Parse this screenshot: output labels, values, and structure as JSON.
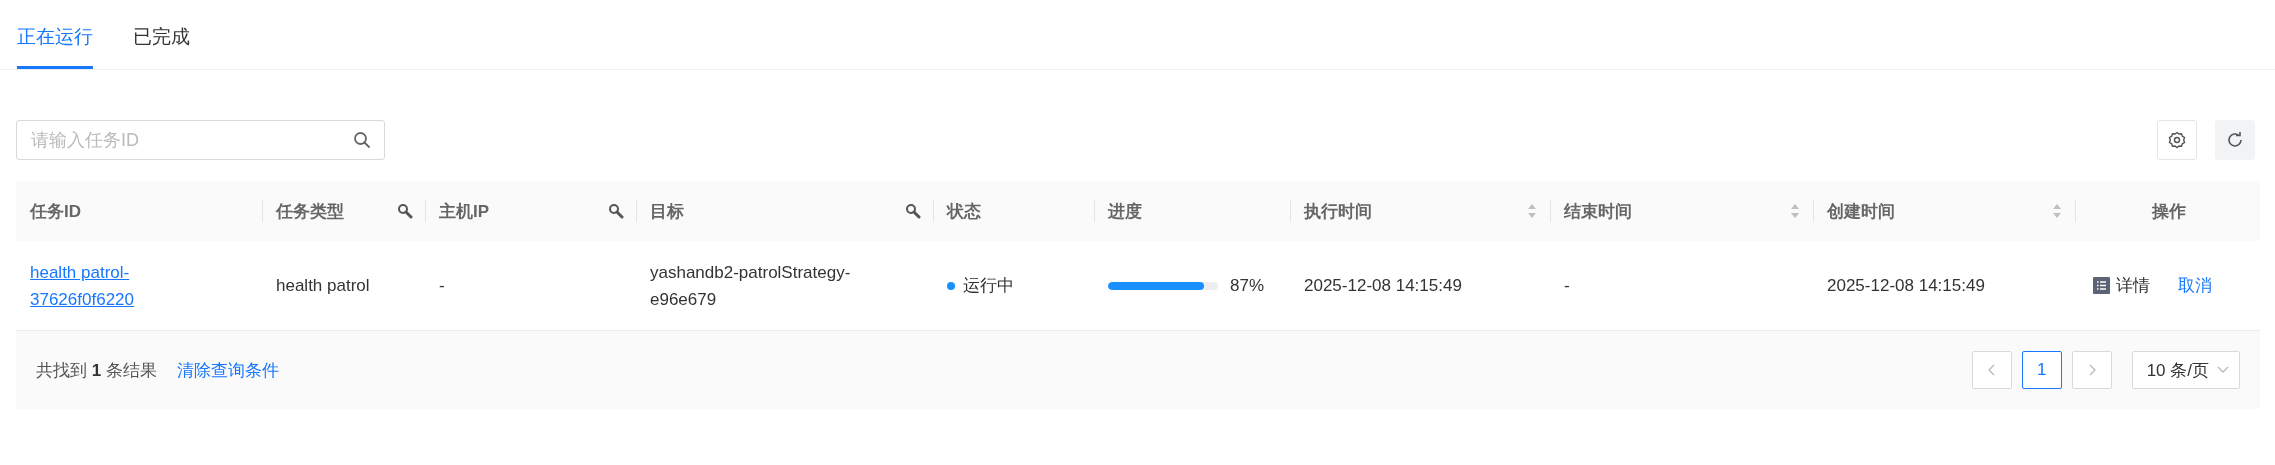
{
  "tabs": [
    {
      "label": "正在运行",
      "selected": true
    },
    {
      "label": "已完成",
      "selected": false
    }
  ],
  "search": {
    "placeholder": "请输入任务ID"
  },
  "table": {
    "columns": [
      {
        "label": "任务ID",
        "kind": "plain"
      },
      {
        "label": "任务类型",
        "kind": "filter"
      },
      {
        "label": "主机IP",
        "kind": "filter"
      },
      {
        "label": "目标",
        "kind": "filter"
      },
      {
        "label": "状态",
        "kind": "plain"
      },
      {
        "label": "进度",
        "kind": "plain"
      },
      {
        "label": "执行时间",
        "kind": "sort"
      },
      {
        "label": "结束时间",
        "kind": "sort"
      },
      {
        "label": "创建时间",
        "kind": "sort"
      },
      {
        "label": "操作",
        "kind": "center"
      }
    ],
    "rows": [
      {
        "task_id": "health patrol-37626f0f6220",
        "task_type": "health patrol",
        "host_ip": "-",
        "target": "yashandb2-patrolStrategy-e96e679",
        "status": {
          "text": "运行中",
          "color": "#1890ff"
        },
        "progress": {
          "level": 0.87,
          "reading": "87%"
        },
        "exec_time": "2025-12-08 14:15:49",
        "end_time": "-",
        "create_time": "2025-12-08 14:15:49",
        "actions": [
          {
            "label": "详情",
            "kind": "detail"
          },
          {
            "label": "取消",
            "kind": "link"
          }
        ]
      }
    ]
  },
  "footer": {
    "summary": "共找到 **1** 条结果",
    "clear_link": "清除查询条件"
  },
  "pagination": {
    "pages": [
      {
        "label": "1",
        "selected": true
      }
    ],
    "page_size": "10 条/页"
  }
}
